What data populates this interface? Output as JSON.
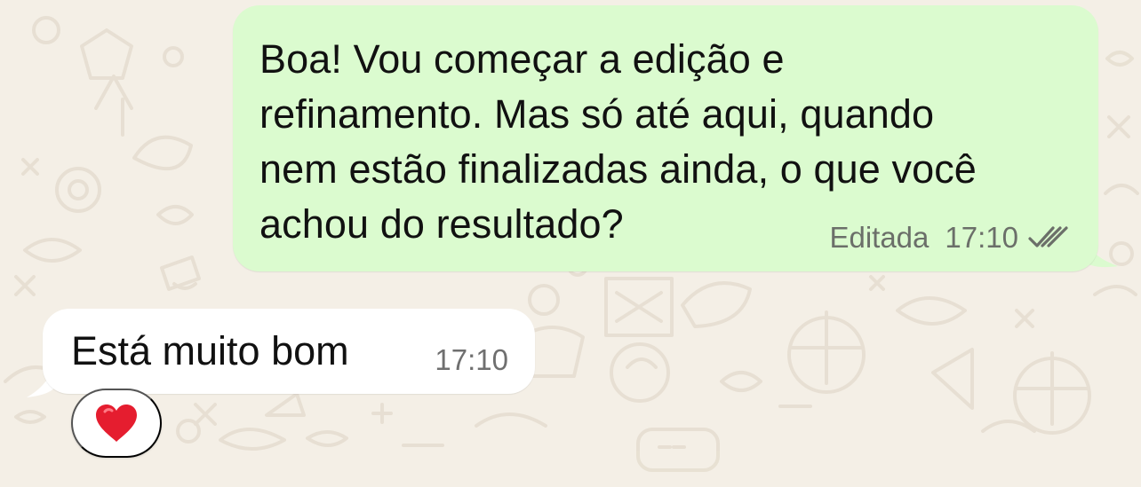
{
  "chat": {
    "messages": [
      {
        "direction": "outgoing",
        "text": "Boa! Vou começar a edição e\nrefinamento. Mas só até aqui, quando\nnem estão finalizadas ainda, o que você\nachou do resultado?",
        "edited_label": "Editada",
        "time": "17:10",
        "status_icon": "double-check-icon"
      },
      {
        "direction": "incoming",
        "text": "Está muito bom",
        "time": "17:10",
        "reaction": "heart-icon"
      }
    ]
  },
  "theme": {
    "background": "#f4efe6",
    "outgoing_bubble": "#dbfbcf",
    "incoming_bubble": "#ffffff",
    "doodle_stroke": "#e7dfd2",
    "meta_text": "#6b6f69",
    "heart": "#e51d2f"
  }
}
